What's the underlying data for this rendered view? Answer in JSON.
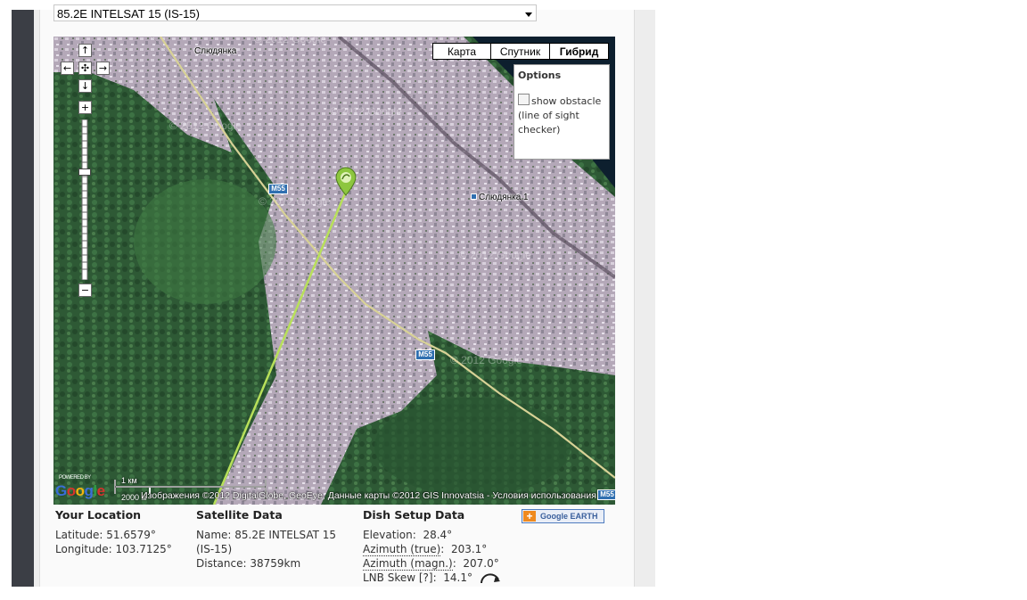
{
  "satellite_select": {
    "value": "85.2E INTELSAT 15 (IS-15)"
  },
  "map": {
    "type_buttons": [
      "Карта",
      "Спутник",
      "Гибрид"
    ],
    "active_type": "Гибрид",
    "options": {
      "title": "Options",
      "checkbox_label": "show obstacle (line of sight checker)",
      "checked": false
    },
    "places": {
      "top": "Слюдянка",
      "right": "Слюдянка 1"
    },
    "road": "M55",
    "watermark": "© 2012 Google",
    "scale": {
      "km": "1 км",
      "m": "2000 м"
    },
    "attribution": "Изображения ©2012 DigitalGlobe, GeoEye, Данные карты ©2012 GIS Innovatsia - Условия использования",
    "google_logo": "Google",
    "powered_by": "POWERED BY"
  },
  "location": {
    "heading": "Your Location",
    "latitude": "Latitude: 51.6579°",
    "longitude": "Longitude: 103.7125°"
  },
  "satellite_data": {
    "heading": "Satellite Data",
    "name": "Name: 85.2E INTELSAT 15 (IS-15)",
    "distance": "Distance: 38759km"
  },
  "dish_setup": {
    "heading": "Dish Setup Data",
    "elevation_label": "Elevation:",
    "elevation_value": "28.4°",
    "azimuth_true_label": "Azimuth (true)",
    "azimuth_true_value": "203.1°",
    "azimuth_magn_label": "Azimuth (magn.)",
    "azimuth_magn_value": "207.0°",
    "lnb_label": "LNB Skew [?]:",
    "lnb_value": "14.1°"
  },
  "google_earth": {
    "label": "Google EARTH"
  },
  "colors": {
    "sidebar": "#3b3e45",
    "forest": "#2f5a36",
    "urban": "#b7aab8",
    "sightline": "#b8e05a"
  }
}
